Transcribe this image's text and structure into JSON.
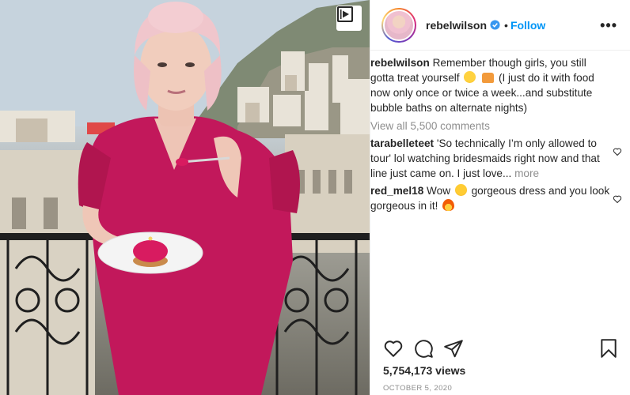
{
  "post": {
    "author": "rebelwilson",
    "follow_label": "Follow",
    "separator": "•",
    "more_options": "•••",
    "caption": {
      "user": "rebelwilson",
      "text_1": "Remember though girls, you still gotta treat yourself",
      "text_2": "(I just do it with food now only once or twice a week...and substitute bubble baths on alternate nights)"
    },
    "view_all_comments": "View all 5,500 comments",
    "comments": [
      {
        "user": "tarabelleteet",
        "text": "'So technically I’m only allowed to tour' lol watching bridesmaids right now and that line just came on. I just love...",
        "more": "more"
      },
      {
        "user": "red_mel18",
        "text_1": "Wow",
        "text_2": "gorgeous dress and you look gorgeous in it!"
      }
    ],
    "views": "5,754,173 views",
    "date": "OCTOBER 5, 2020"
  },
  "icons": {
    "video": "video-icon",
    "verified": "verified-badge-icon",
    "like": "heart-icon",
    "comment": "comment-icon",
    "share": "share-icon",
    "save": "bookmark-icon"
  },
  "colors": {
    "accent": "#0095f6",
    "muted": "#8e8e8e",
    "dress": "#c2185b"
  }
}
